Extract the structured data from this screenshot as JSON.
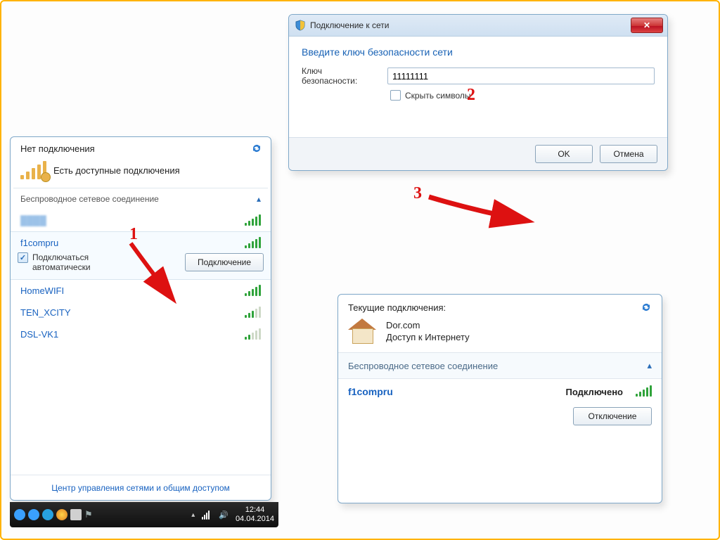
{
  "annotations": {
    "step1": "1",
    "step2": "2",
    "step3": "3"
  },
  "dialog": {
    "title": "Подключение к сети",
    "heading": "Введите ключ безопасности сети",
    "key_label": "Ключ\nбезопасности:",
    "key_value": "11111111",
    "hide_chars_label": "Скрыть символы",
    "ok_label": "OK",
    "cancel_label": "Отмена"
  },
  "netpop": {
    "header": "Нет подключения",
    "status_line": "Есть доступные подключения",
    "section_title": "Беспроводное сетевое соединение",
    "networks": [
      {
        "name": "",
        "strength": "full",
        "blurred": true
      },
      {
        "name": "f1compru",
        "strength": "full",
        "expanded": true
      },
      {
        "name": "HomeWIFI",
        "strength": "full"
      },
      {
        "name": "TEN_XCITY",
        "strength": "med"
      },
      {
        "name": "DSL-VK1",
        "strength": "weak"
      }
    ],
    "auto_connect_label": "Подключаться\nавтоматически",
    "connect_btn": "Подключение",
    "footer_link": "Центр управления сетями и общим доступом"
  },
  "taskbar": {
    "time": "12:44",
    "date": "04.04.2014"
  },
  "connpop": {
    "header": "Текущие подключения:",
    "home_name": "Dor.com",
    "home_status": "Доступ к Интернету",
    "section_title": "Беспроводное сетевое соединение",
    "net_name": "f1compru",
    "net_status": "Подключено",
    "disconnect_btn": "Отключение"
  }
}
